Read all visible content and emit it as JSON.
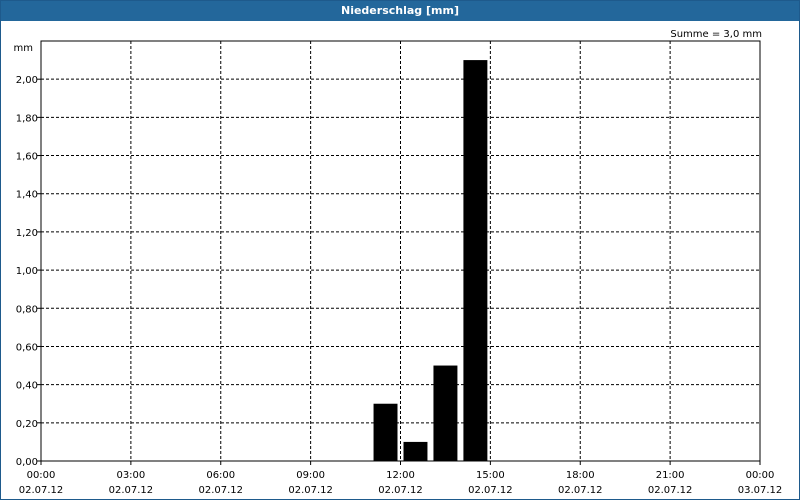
{
  "window": {
    "title": "Niederschlag [mm]"
  },
  "chart_data": {
    "type": "bar",
    "title": "Niederschlag [mm]",
    "ylabel": "mm",
    "ylim": [
      0,
      2.2
    ],
    "yticks": [
      0,
      0.2,
      0.4,
      0.6,
      0.8,
      1.0,
      1.2,
      1.4,
      1.6,
      1.8,
      2.0
    ],
    "ytick_labels": [
      "0,00",
      "0,20",
      "0,40",
      "0,60",
      "0,80",
      "1,00",
      "1,20",
      "1,40",
      "1,60",
      "1,80",
      "2,00"
    ],
    "x_hours_range": [
      0,
      24
    ],
    "xticks": [
      {
        "hour": 0,
        "time": "00:00",
        "date": "02.07.12"
      },
      {
        "hour": 3,
        "time": "03:00",
        "date": "02.07.12"
      },
      {
        "hour": 6,
        "time": "06:00",
        "date": "02.07.12"
      },
      {
        "hour": 9,
        "time": "09:00",
        "date": "02.07.12"
      },
      {
        "hour": 12,
        "time": "12:00",
        "date": "02.07.12"
      },
      {
        "hour": 15,
        "time": "15:00",
        "date": "02.07.12"
      },
      {
        "hour": 18,
        "time": "18:00",
        "date": "02.07.12"
      },
      {
        "hour": 21,
        "time": "21:00",
        "date": "02.07.12"
      },
      {
        "hour": 24,
        "time": "00:00",
        "date": "03.07.12"
      }
    ],
    "bars": [
      {
        "hour": 11,
        "value": 0.3
      },
      {
        "hour": 12,
        "value": 0.1
      },
      {
        "hour": 13,
        "value": 0.5
      },
      {
        "hour": 14,
        "value": 2.1
      }
    ],
    "summary": "Summe = 3,0 mm",
    "grid": true,
    "bar_color": "#000000"
  }
}
